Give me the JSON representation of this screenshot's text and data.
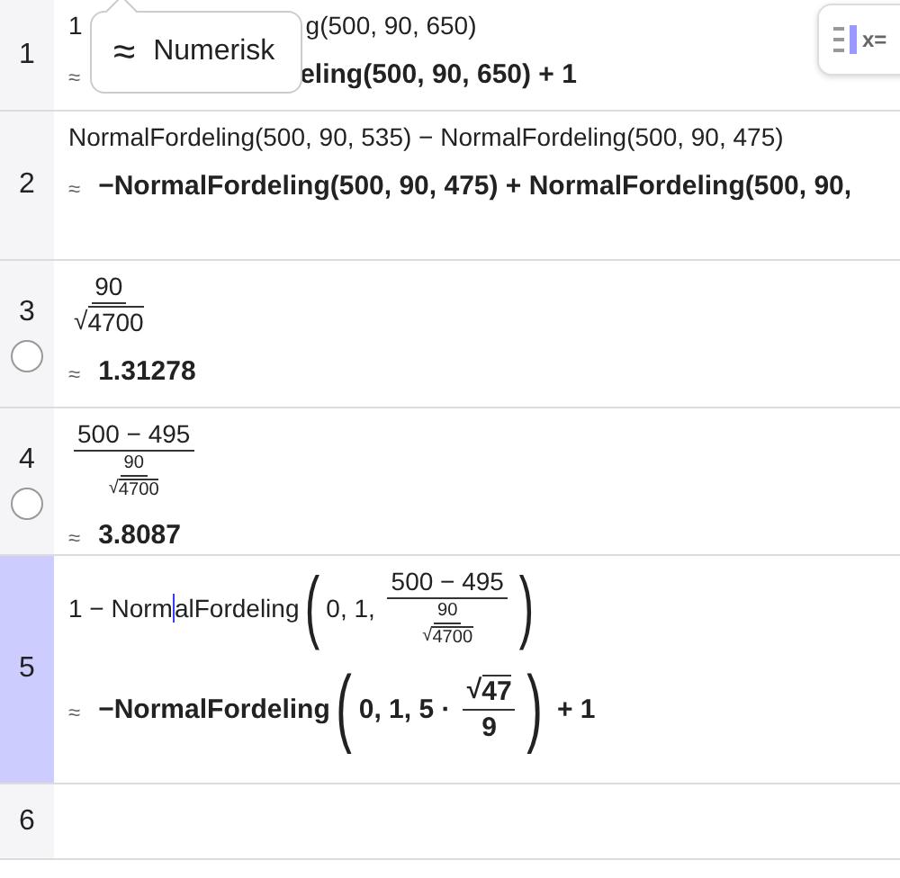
{
  "rows": [
    {
      "number": "1",
      "selected": false,
      "input": [
        {
          "kind": "text",
          "text": "1"
        },
        {
          "kind": "covered"
        },
        {
          "kind": "text",
          "text": "g(500, 90, 650)"
        }
      ],
      "output": [
        {
          "kind": "covered"
        },
        {
          "kind": "text",
          "text": "eling(500, 90, 650) + 1"
        }
      ],
      "approx": "≈"
    },
    {
      "number": "2",
      "selected": false,
      "input": [
        {
          "kind": "text",
          "text": "NormalFordeling(500, 90, 535) − NormalFordeling(500, 90, 475)"
        }
      ],
      "output": [
        {
          "kind": "text",
          "text": "−NormalFordeling(500, 90, 475) + NormalFordeling(500, 90,"
        }
      ],
      "approx": "≈"
    },
    {
      "number": "3",
      "selected": false,
      "visible_in_graphics": false,
      "input": [
        {
          "kind": "frac",
          "num": [
            {
              "kind": "text",
              "text": "90"
            }
          ],
          "den": [
            {
              "kind": "sqrt",
              "sign": "√",
              "body": [
                {
                  "kind": "text",
                  "text": "4700"
                }
              ]
            }
          ]
        }
      ],
      "output": [
        {
          "kind": "text",
          "text": "1.31278"
        }
      ],
      "approx": "≈"
    },
    {
      "number": "4",
      "selected": false,
      "visible_in_graphics": false,
      "input": [
        {
          "kind": "frac",
          "num": [
            {
              "kind": "text",
              "text": "500 − 495"
            }
          ],
          "den": [
            {
              "kind": "frac",
              "num": [
                {
                  "kind": "text",
                  "text": "90"
                }
              ],
              "den": [
                {
                  "kind": "sqrt",
                  "sign": "√",
                  "body": [
                    {
                      "kind": "text",
                      "text": "4700"
                    }
                  ]
                }
              ]
            }
          ]
        }
      ],
      "output": [
        {
          "kind": "text",
          "text": "3.8087"
        }
      ],
      "approx": "≈"
    },
    {
      "number": "5",
      "selected": true,
      "input": [
        {
          "kind": "text",
          "text": "1 − Norm"
        },
        {
          "kind": "caret"
        },
        {
          "kind": "text",
          "text": "alFordeling"
        },
        {
          "kind": "paren",
          "open": "(",
          "close": ")",
          "body": [
            {
              "kind": "text",
              "text": "0, 1, "
            },
            {
              "kind": "frac",
              "num": [
                {
                  "kind": "text",
                  "text": "500 − 495"
                }
              ],
              "den": [
                {
                  "kind": "frac",
                  "num": [
                    {
                      "kind": "text",
                      "text": "90"
                    }
                  ],
                  "den": [
                    {
                      "kind": "sqrt",
                      "sign": "√",
                      "body": [
                        {
                          "kind": "text",
                          "text": "4700"
                        }
                      ]
                    }
                  ]
                }
              ]
            }
          ]
        }
      ],
      "output": [
        {
          "kind": "text",
          "text": "−NormalFordeling"
        },
        {
          "kind": "paren",
          "open": "(",
          "close": ")",
          "body": [
            {
              "kind": "text",
              "text": "0, 1, 5 · "
            },
            {
              "kind": "frac",
              "num": [
                {
                  "kind": "sqrt",
                  "sign": "√",
                  "body": [
                    {
                      "kind": "text",
                      "text": "47"
                    }
                  ]
                }
              ],
              "den": [
                {
                  "kind": "text",
                  "text": "9"
                }
              ]
            }
          ]
        },
        {
          "kind": "text",
          "text": " + 1"
        }
      ],
      "approx": "≈"
    },
    {
      "number": "6",
      "selected": false,
      "input": [],
      "output": []
    }
  ],
  "popup": {
    "symbol": "≈",
    "label": "Numerisk"
  },
  "toolbar_button": {
    "label": "x="
  }
}
